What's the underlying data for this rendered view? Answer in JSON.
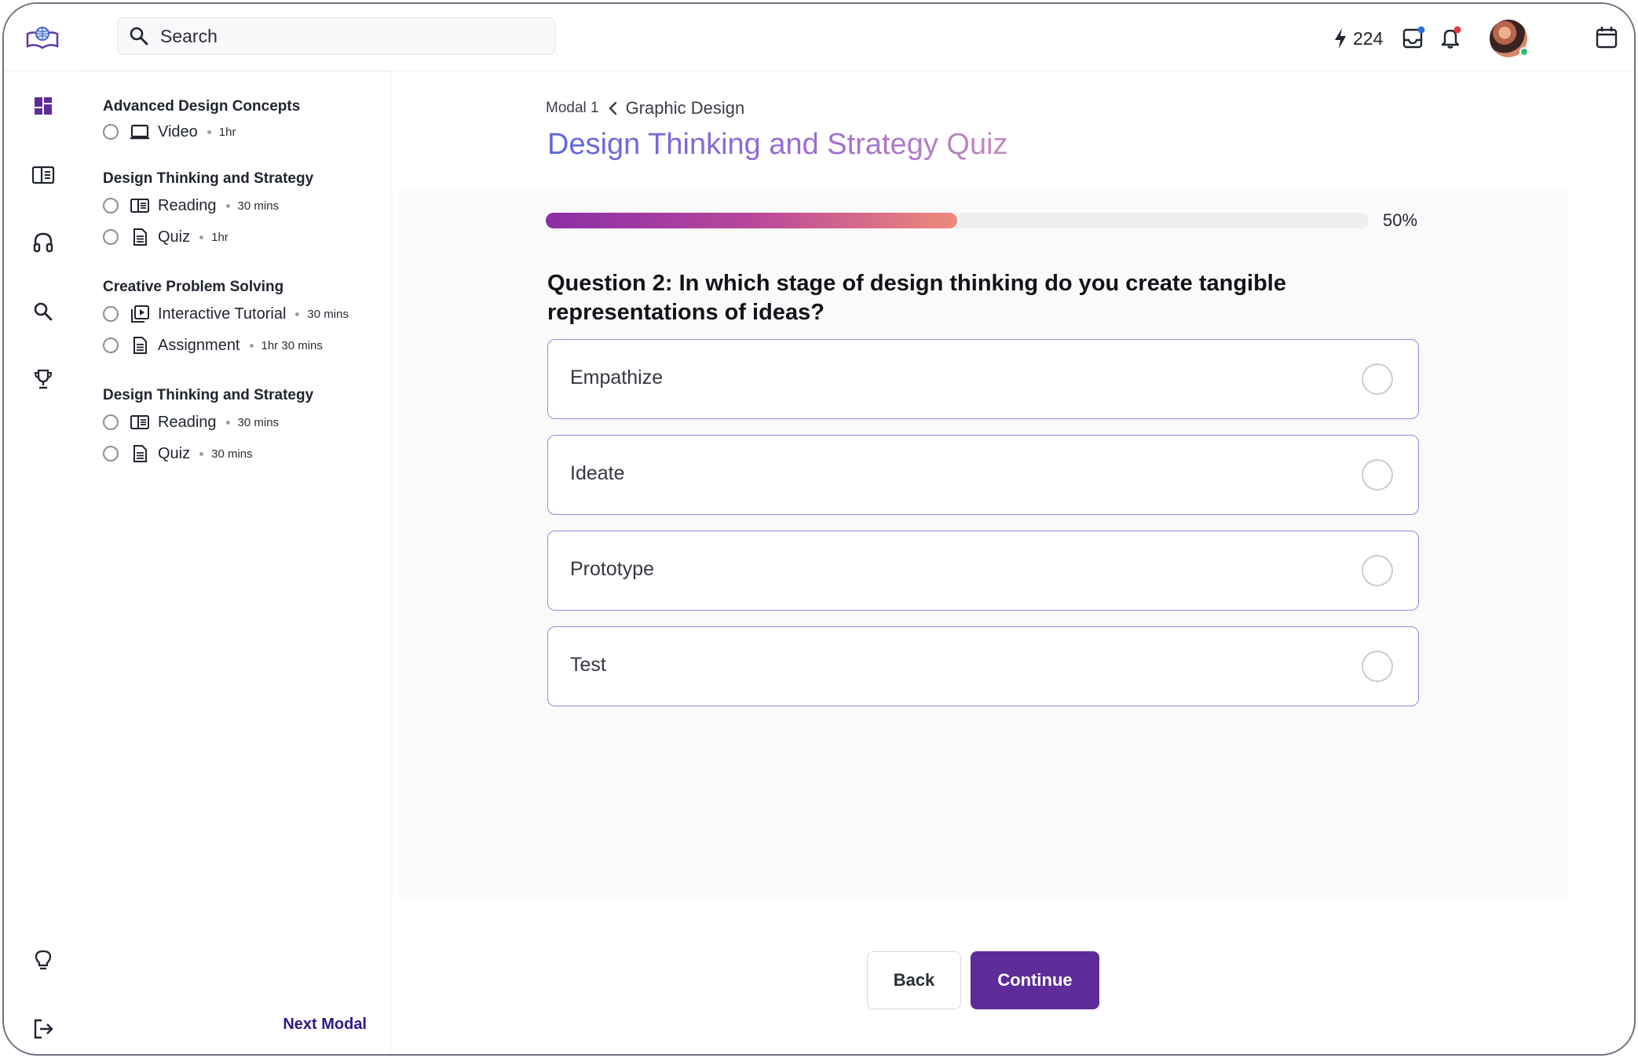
{
  "header": {
    "search_placeholder": "Search",
    "streak_count": "224"
  },
  "outline": {
    "sections": [
      {
        "title": "Advanced Design Concepts",
        "lessons": [
          {
            "type_icon": "video-icon",
            "name": "Video",
            "duration": "1hr"
          }
        ]
      },
      {
        "title": "Design Thinking and Strategy",
        "lessons": [
          {
            "type_icon": "reading-icon",
            "name": "Reading",
            "duration": "30 mins"
          },
          {
            "type_icon": "document-icon",
            "name": "Quiz",
            "duration": "1hr"
          }
        ]
      },
      {
        "title": "Creative Problem Solving",
        "lessons": [
          {
            "type_icon": "play-tutorial-icon",
            "name": "Interactive Tutorial",
            "duration": "30 mins"
          },
          {
            "type_icon": "document-icon",
            "name": "Assignment",
            "duration": "1hr 30 mins"
          }
        ]
      },
      {
        "title": "Design Thinking and Strategy",
        "lessons": [
          {
            "type_icon": "reading-icon",
            "name": "Reading",
            "duration": "30 mins"
          },
          {
            "type_icon": "document-icon",
            "name": "Quiz",
            "duration": "30 mins"
          }
        ]
      }
    ],
    "next_label": "Next Modal"
  },
  "main": {
    "breadcrumb": {
      "parent": "Modal 1",
      "current": "Graphic Design"
    },
    "title": "Design Thinking and Strategy Quiz",
    "progress": {
      "value": 0.5,
      "label": "50%"
    },
    "question": "Question 2: In which stage of design thinking do you create tangible representations of ideas?",
    "options": [
      "Empathize",
      "Ideate",
      "Prototype",
      "Test"
    ],
    "back_label": "Back",
    "continue_label": "Continue"
  },
  "colors": {
    "accent": "#5e2c99",
    "option_border": "#8f8be0",
    "next_link": "#2c1a86",
    "notification_dot": "#e03a3a",
    "inbox_dot": "#2f6fe0"
  }
}
